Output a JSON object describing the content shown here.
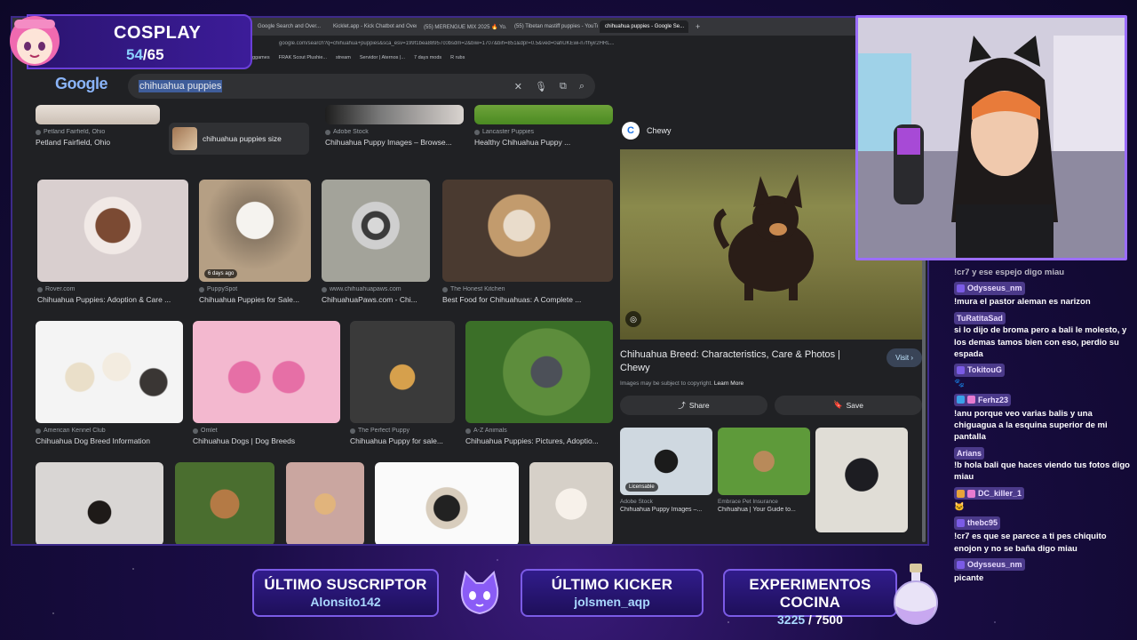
{
  "browser": {
    "tabs": [
      {
        "label": "Google Search and Over..."
      },
      {
        "label": "Kicklet.app - Kick Chatbot and Overl..."
      },
      {
        "label": "(55) MERENGUE MIX 2025 🔥 Yo..."
      },
      {
        "label": "(55) Tibetan mastiff puppies - YouTu..."
      },
      {
        "label": "chihuahua puppies - Google Se..."
      }
    ],
    "address": "google.com/search?q=chihuahua+puppies&sca_esv=199f1bea88957c0bsdm=2&biw=1707&bih=851&dpr=0.5&ved=0ahUKEwi-n7fhyir2HRL...",
    "bookmarks": [
      "ggames",
      "FRAK Scout Plushie...",
      "stream",
      "Servidor | Aternos |...",
      "7 days mods",
      "R rubs"
    ],
    "logo": "Google",
    "search_query": "chihuahua puppies"
  },
  "results": {
    "row0": [
      {
        "source": "Petland Fairfield, Ohio",
        "caption": "Petland Fairfield, Ohio"
      },
      {
        "source": "Adobe Stock",
        "caption": "Chihuahua Puppy Images – Browse..."
      },
      {
        "source": "Lancaster Puppies",
        "caption": "Healthy Chihuahua Puppy ..."
      }
    ],
    "related_search": "chihuahua puppies size",
    "row1": [
      {
        "source": "Rover.com",
        "caption": "Chihuahua Puppies: Adoption & Care ..."
      },
      {
        "source": "PuppySpot",
        "caption": "Chihuahua Puppies for Sale...",
        "badge": "6 days ago"
      },
      {
        "source": "www.chihuahuapaws.com",
        "caption": "ChihuahuaPaws.com - Chi..."
      },
      {
        "source": "The Honest Kitchen",
        "caption": "Best Food for Chihuahuas: A Complete ..."
      }
    ],
    "row2": [
      {
        "source": "American Kennel Club",
        "caption": "Chihuahua Dog Breed Information"
      },
      {
        "source": "Omlet",
        "caption": "Chihuahua Dogs | Dog Breeds"
      },
      {
        "source": "The Perfect Puppy",
        "caption": "Chihuahua Puppy for sale..."
      },
      {
        "source": "A-Z Animals",
        "caption": "Chihuahua Puppies: Pictures, Adoptio..."
      }
    ]
  },
  "preview": {
    "site": "Chewy",
    "site_initial": "C",
    "title": "Chihuahua Breed: Characteristics, Care & Photos | Chewy",
    "visit_label": "Visit",
    "copyright": "Images may be subject to copyright.",
    "learn_more": "Learn More",
    "share_label": "Share",
    "save_label": "Save",
    "related": [
      {
        "source": "Adobe Stock",
        "caption": "Chihuahua Puppy Images –...",
        "badge": "Licensable"
      },
      {
        "source": "Embrace Pet Insurance",
        "caption": "Chihuahua | Your Guide to..."
      }
    ]
  },
  "cosplay": {
    "title": "COSPLAY",
    "current": "54",
    "total": "/65"
  },
  "chat": [
    {
      "user": "",
      "text": "!cr7 y ese espejo digo miau"
    },
    {
      "user": "Odysseus_nm",
      "text": "!mura el pastor aleman es narizon"
    },
    {
      "user": "TuRatitaSad",
      "text": "si lo dijo de broma pero a bali le molesto, y los demas tamos bien con eso, perdio su espada"
    },
    {
      "user": "TokitouG",
      "text": ""
    },
    {
      "user": "Ferhz23",
      "text": "!anu porque veo varias balis y una chiguagua a la esquina superior de mi pantalla"
    },
    {
      "user": "Arians",
      "text": "!b hola bali que haces viendo tus fotos digo miau"
    },
    {
      "user": "DC_killer_1",
      "text": ""
    },
    {
      "user": "thebc95",
      "text": "!cr7 es que se parece a ti pes chiquito enojon y no se baña digo miau"
    },
    {
      "user": "Odysseus_nm",
      "text": "picante"
    }
  ],
  "stats": {
    "sub_label": "ÚLTIMO SUSCRIPTOR",
    "sub_value": "Alonsito142",
    "kicker_label": "ÚLTIMO KICKER",
    "kicker_value": "jolsmen_aqp",
    "exp_label": "EXPERIMENTOS COCINA",
    "exp_current": "3225",
    "exp_total": " / 7500"
  },
  "colors": {
    "accent_purple": "#7b5be6",
    "frame": "#9b6dff",
    "google_dark": "#202124"
  }
}
